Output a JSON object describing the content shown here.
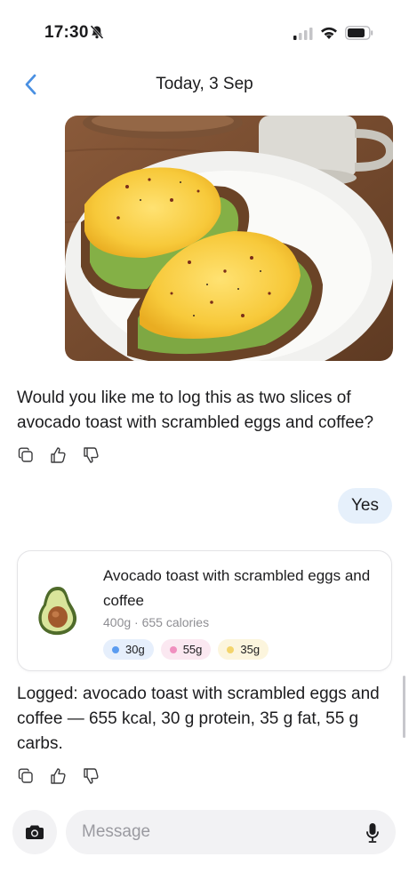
{
  "status_bar": {
    "time": "17:30",
    "icons": [
      "bell-slash-icon",
      "signal-icon",
      "wifi-icon",
      "battery-icon"
    ]
  },
  "nav": {
    "back_icon": "chevron-left-icon",
    "title": "Today, 3 Sep"
  },
  "messages": {
    "assistant_question": "Would you like me to log this as two slices of avocado toast with scrambled eggs and coffee?",
    "user_reply": "Yes",
    "assistant_confirmation": "Logged: avocado toast with scrambled eggs and coffee — 655 kcal, 30 g protein, 35 g fat, 55 g carbs."
  },
  "message_actions": [
    "copy-icon",
    "thumbs-up-icon",
    "thumbs-down-icon"
  ],
  "food_card": {
    "icon": "avocado-icon",
    "title": "Avocado toast with scrambled eggs and coffee",
    "meta": "400g · 655 calories",
    "macros": [
      {
        "value": "30g",
        "color": "#5b9cf0"
      },
      {
        "value": "55g",
        "color": "#f08fbf"
      },
      {
        "value": "35g",
        "color": "#f3d46b"
      }
    ]
  },
  "composer": {
    "placeholder": "Message",
    "camera_icon": "camera-icon",
    "mic_icon": "mic-icon"
  },
  "colors": {
    "accent": "#4a90e2",
    "user_bubble": "#e6f0fb",
    "input_bg": "#f2f2f4"
  }
}
